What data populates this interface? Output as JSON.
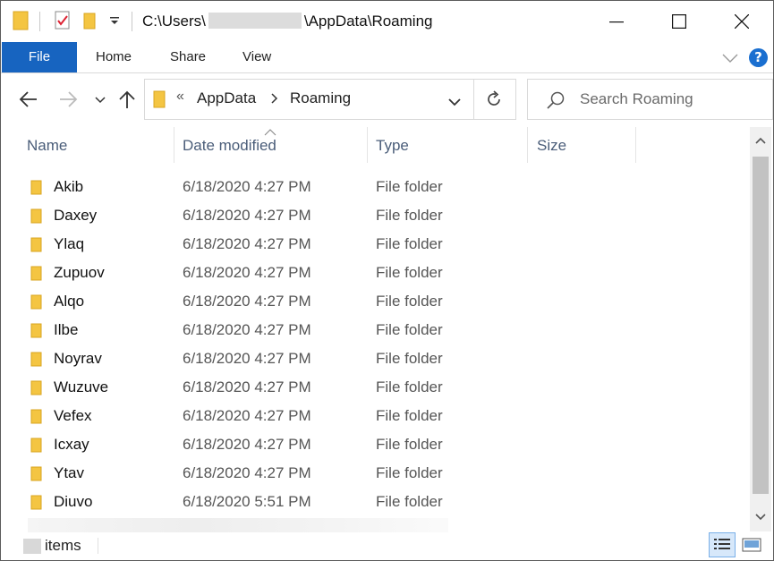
{
  "window": {
    "title_prefix": "C:\\Users\\",
    "title_suffix": "\\AppData\\Roaming"
  },
  "ribbon": {
    "tabs": [
      "File",
      "Home",
      "Share",
      "View"
    ],
    "help_label": "?"
  },
  "address": {
    "overflow": "«",
    "segments": [
      "AppData",
      "Roaming"
    ]
  },
  "search": {
    "placeholder": "Search Roaming"
  },
  "columns": [
    "Name",
    "Date modified",
    "Type",
    "Size"
  ],
  "files": [
    {
      "name": "Akib",
      "date": "6/18/2020 4:27 PM",
      "type": "File folder"
    },
    {
      "name": "Daxey",
      "date": "6/18/2020 4:27 PM",
      "type": "File folder"
    },
    {
      "name": "Ylaq",
      "date": "6/18/2020 4:27 PM",
      "type": "File folder"
    },
    {
      "name": "Zupuov",
      "date": "6/18/2020 4:27 PM",
      "type": "File folder"
    },
    {
      "name": "Alqo",
      "date": "6/18/2020 4:27 PM",
      "type": "File folder"
    },
    {
      "name": "Ilbe",
      "date": "6/18/2020 4:27 PM",
      "type": "File folder"
    },
    {
      "name": "Noyrav",
      "date": "6/18/2020 4:27 PM",
      "type": "File folder"
    },
    {
      "name": "Wuzuve",
      "date": "6/18/2020 4:27 PM",
      "type": "File folder"
    },
    {
      "name": "Vefex",
      "date": "6/18/2020 4:27 PM",
      "type": "File folder"
    },
    {
      "name": "Icxay",
      "date": "6/18/2020 4:27 PM",
      "type": "File folder"
    },
    {
      "name": "Ytav",
      "date": "6/18/2020 4:27 PM",
      "type": "File folder"
    },
    {
      "name": "Diuvo",
      "date": "6/18/2020 5:51 PM",
      "type": "File folder"
    }
  ],
  "status": {
    "items_label": "items"
  },
  "colors": {
    "accent": "#1764c0",
    "folder": "#f4c542",
    "header_text": "#4a5d79"
  }
}
